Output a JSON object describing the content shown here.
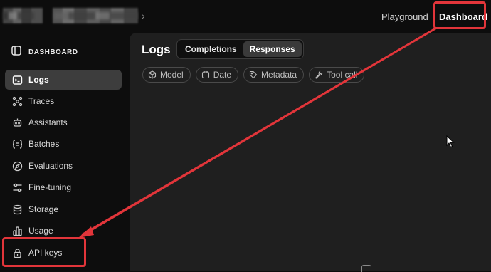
{
  "topbar": {
    "nav": {
      "playground_label": "Playground",
      "dashboard_label": "Dashboard"
    }
  },
  "sidebar": {
    "header_label": "DASHBOARD",
    "items": [
      {
        "label": "Logs",
        "icon": "logs-icon",
        "active": true
      },
      {
        "label": "Traces",
        "icon": "traces-icon"
      },
      {
        "label": "Assistants",
        "icon": "assistants-icon"
      },
      {
        "label": "Batches",
        "icon": "batches-icon"
      },
      {
        "label": "Evaluations",
        "icon": "evaluations-icon"
      },
      {
        "label": "Fine-tuning",
        "icon": "fine-tuning-icon"
      },
      {
        "label": "Storage",
        "icon": "storage-icon"
      },
      {
        "label": "Usage",
        "icon": "usage-icon"
      },
      {
        "label": "API keys",
        "icon": "lock-icon"
      }
    ]
  },
  "main": {
    "title": "Logs",
    "tabs": [
      {
        "label": "Completions",
        "active": false
      },
      {
        "label": "Responses",
        "active": true
      }
    ],
    "filters": [
      {
        "label": "Model",
        "icon": "cube-icon"
      },
      {
        "label": "Date",
        "icon": "calendar-icon"
      },
      {
        "label": "Metadata",
        "icon": "tag-icon"
      },
      {
        "label": "Tool call",
        "icon": "wrench-icon"
      }
    ]
  },
  "colors": {
    "highlight": "#e2353a",
    "page_bg": "#0d0d0d",
    "panel_bg": "#1f1f1f",
    "active_item_bg": "#3d3d3d"
  }
}
